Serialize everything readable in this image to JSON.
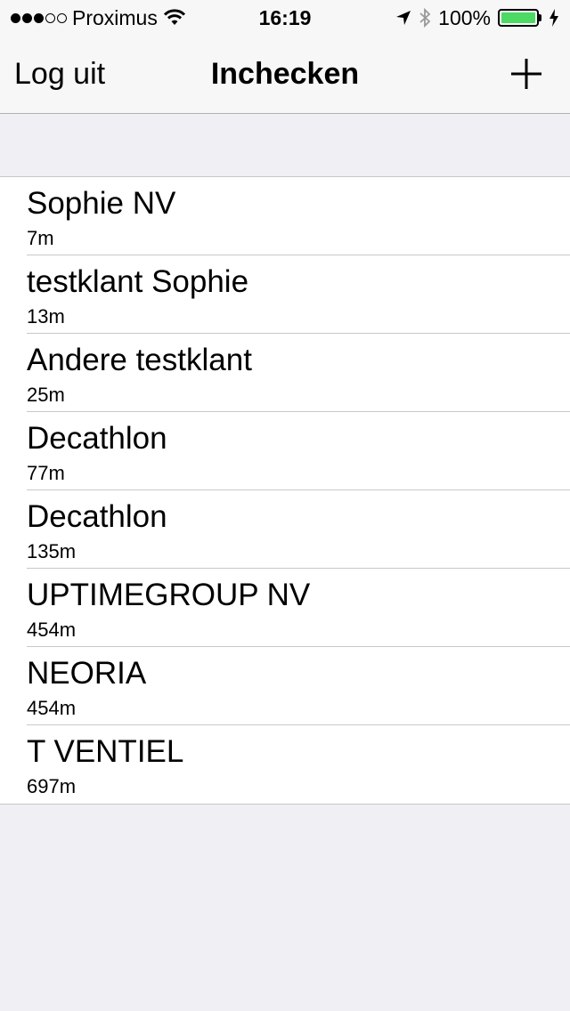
{
  "status_bar": {
    "signal_dots_filled": 3,
    "signal_dots_total": 5,
    "carrier": "Proximus",
    "time": "16:19",
    "battery_percent": "100%",
    "battery_level": 1.0,
    "battery_color": "#4cd964",
    "icons": [
      "wifi-icon",
      "location-arrow-icon",
      "bluetooth-icon",
      "battery-icon",
      "charging-bolt-icon"
    ]
  },
  "nav": {
    "left_button": "Log uit",
    "title": "Inchecken",
    "right_icon": "plus-icon"
  },
  "locations": [
    {
      "name": "Sophie NV",
      "distance": "7m"
    },
    {
      "name": "testklant Sophie",
      "distance": "13m"
    },
    {
      "name": "Andere testklant",
      "distance": "25m"
    },
    {
      "name": "Decathlon",
      "distance": "77m"
    },
    {
      "name": "Decathlon",
      "distance": "135m"
    },
    {
      "name": "UPTIMEGROUP NV",
      "distance": "454m"
    },
    {
      "name": "NEORIA",
      "distance": "454m"
    },
    {
      "name": "T VENTIEL",
      "distance": "697m"
    }
  ]
}
